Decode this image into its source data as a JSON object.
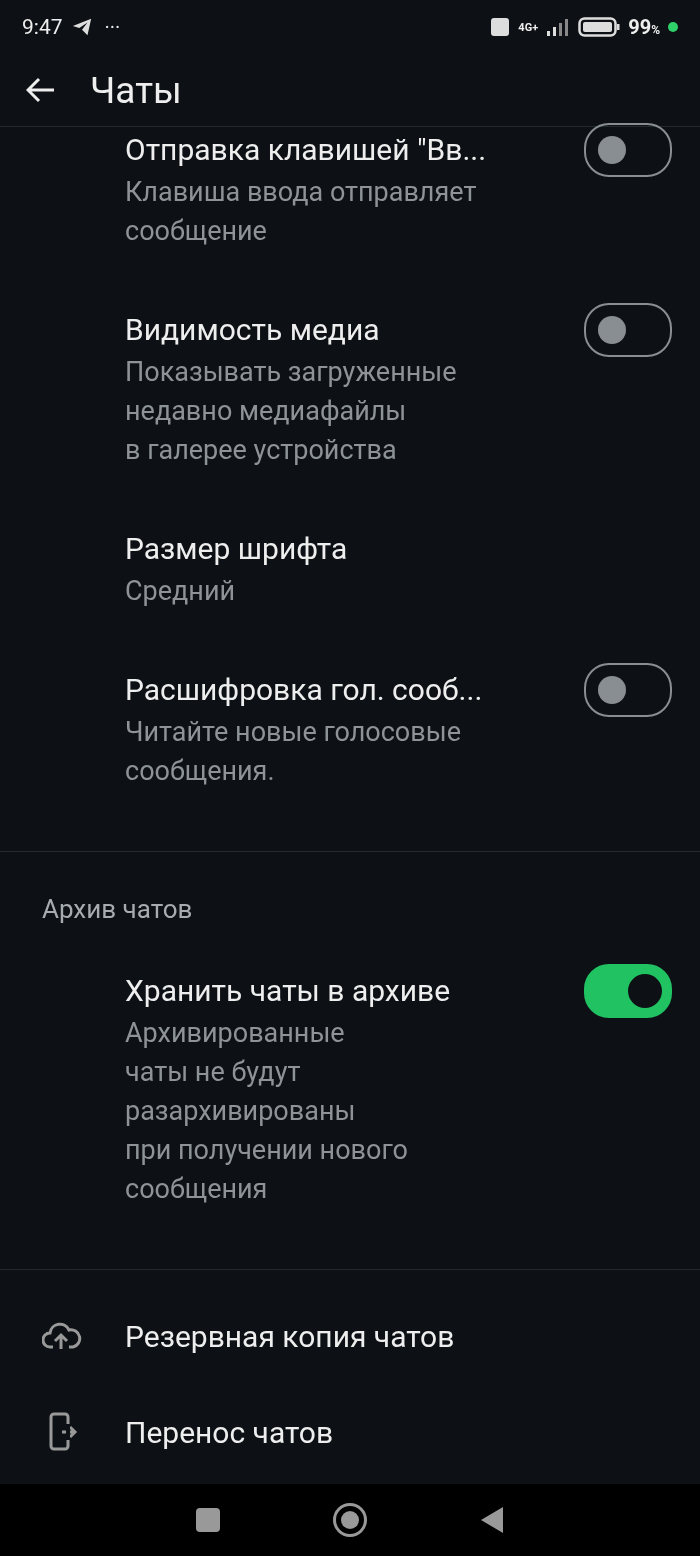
{
  "status_bar": {
    "time": "9:47",
    "more": "···",
    "network": "4G+",
    "battery": "99",
    "battery_unit": "%"
  },
  "header": {
    "title": "Чаты"
  },
  "sections": [
    {
      "items": [
        {
          "kind": "toggle",
          "title": "Отправка клавишей \"Вв...",
          "subtitle": [
            "Клавиша ввода отправляет",
            "сообщение"
          ],
          "on": false
        },
        {
          "kind": "toggle",
          "title": "Видимость медиа",
          "subtitle": [
            "Показывать загруженные",
            "недавно медиафайлы",
            "в галерее устройства"
          ],
          "on": false
        },
        {
          "kind": "value",
          "title": "Размер шрифта",
          "subtitle": [
            "Средний"
          ]
        },
        {
          "kind": "toggle",
          "title": "Расшифровка гол. сооб...",
          "subtitle": [
            "Читайте новые голосовые",
            "сообщения."
          ],
          "on": false
        }
      ]
    },
    {
      "heading": "Архив чатов",
      "items": [
        {
          "kind": "toggle",
          "title": "Хранить чаты в архиве",
          "subtitle": [
            "Архивированные",
            "чаты не будут",
            "разархивированы",
            "при получении нового",
            "сообщения"
          ],
          "on": true
        }
      ]
    },
    {
      "items": [
        {
          "kind": "link",
          "title": "Резервная копия чатов"
        },
        {
          "kind": "link",
          "title": "Перенос чатов"
        }
      ]
    }
  ]
}
